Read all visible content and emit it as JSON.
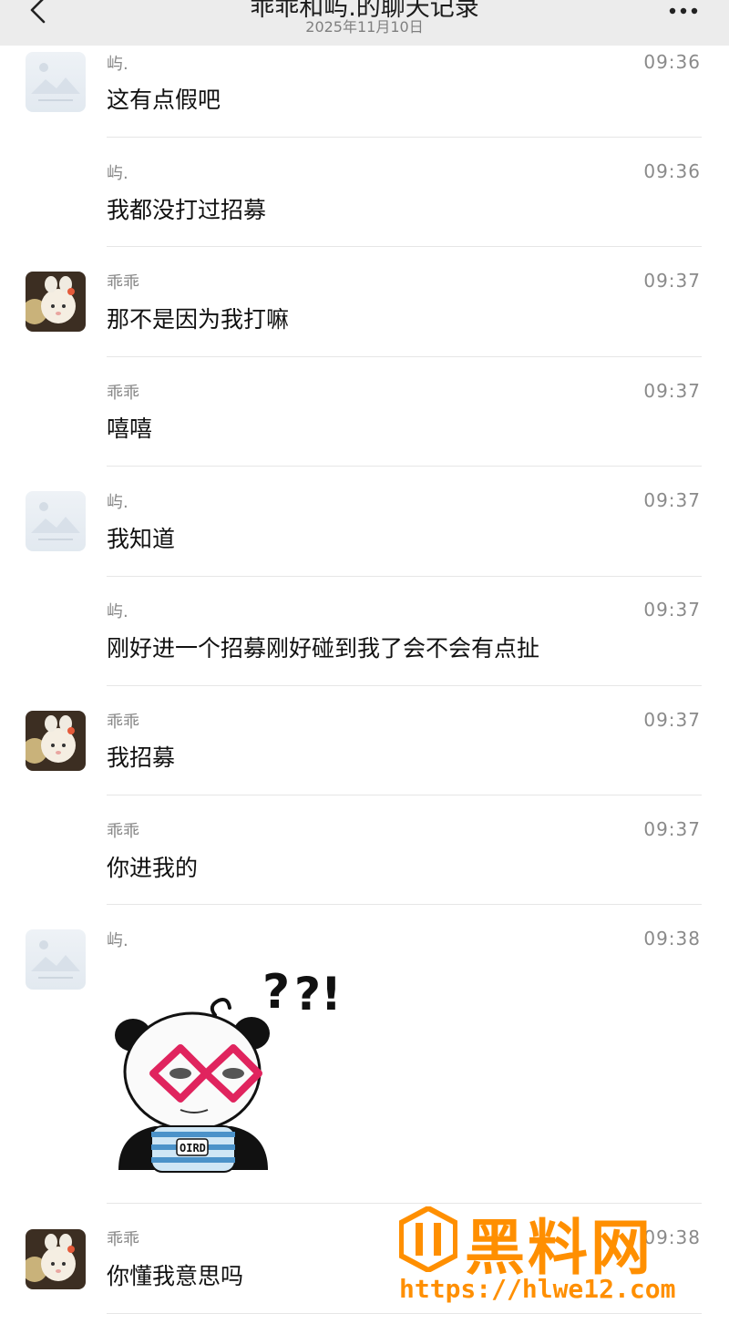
{
  "header": {
    "title": "乖乖和屿.的聊天记录",
    "date": "2025年11月10日",
    "back_icon": "chevron-left-icon",
    "more_icon": "more-horizontal-icon"
  },
  "messages": [
    {
      "sender": "屿.",
      "time": "09:36",
      "text": "这有点假吧",
      "avatar": "placeholder"
    },
    {
      "sender": "屿.",
      "time": "09:36",
      "text": "我都没打过招募",
      "avatar": null
    },
    {
      "sender": "乖乖",
      "time": "09:37",
      "text": "那不是因为我打嘛",
      "avatar": "cat"
    },
    {
      "sender": "乖乖",
      "time": "09:37",
      "text": "嘻嘻",
      "avatar": null
    },
    {
      "sender": "屿.",
      "time": "09:37",
      "text": "我知道",
      "avatar": "placeholder"
    },
    {
      "sender": "屿.",
      "time": "09:37",
      "text": "刚好进一个招募刚好碰到我了会不会有点扯",
      "avatar": null
    },
    {
      "sender": "乖乖",
      "time": "09:37",
      "text": "我招募",
      "avatar": "cat"
    },
    {
      "sender": "乖乖",
      "time": "09:37",
      "text": "你进我的",
      "avatar": null
    },
    {
      "sender": "屿.",
      "time": "09:38",
      "text": "",
      "avatar": "placeholder",
      "sticker": "panda-glasses-sticker"
    },
    {
      "sender": "乖乖",
      "time": "09:38",
      "text": "你懂我意思吗",
      "avatar": "cat"
    }
  ],
  "watermark": {
    "brand": "黑料网",
    "url": "https://hlwe12.com",
    "color": "#ff8f00"
  }
}
